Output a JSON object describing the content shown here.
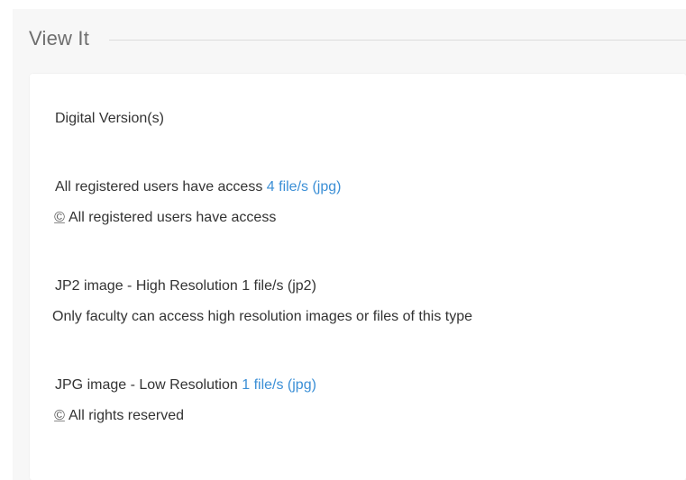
{
  "section": {
    "title": "View It"
  },
  "digital": {
    "heading": "Digital Version(s)",
    "items": [
      {
        "access_text": "All registered users have access",
        "link_text": "4 file/s (jpg)",
        "rights_symbol": "©",
        "rights_text": "All registered users have access"
      },
      {
        "access_text": "JP2 image - High Resolution 1 file/s (jp2)",
        "restriction_text": "Only faculty can access high resolution images or files of this type"
      },
      {
        "access_text": "JPG image - Low Resolution",
        "link_text": "1 file/s (jpg)",
        "rights_symbol": "©",
        "rights_text": "All rights reserved"
      }
    ]
  },
  "colors": {
    "link": "#3b8fd6",
    "text": "#333333",
    "panel_bg": "#f7f7f7"
  }
}
